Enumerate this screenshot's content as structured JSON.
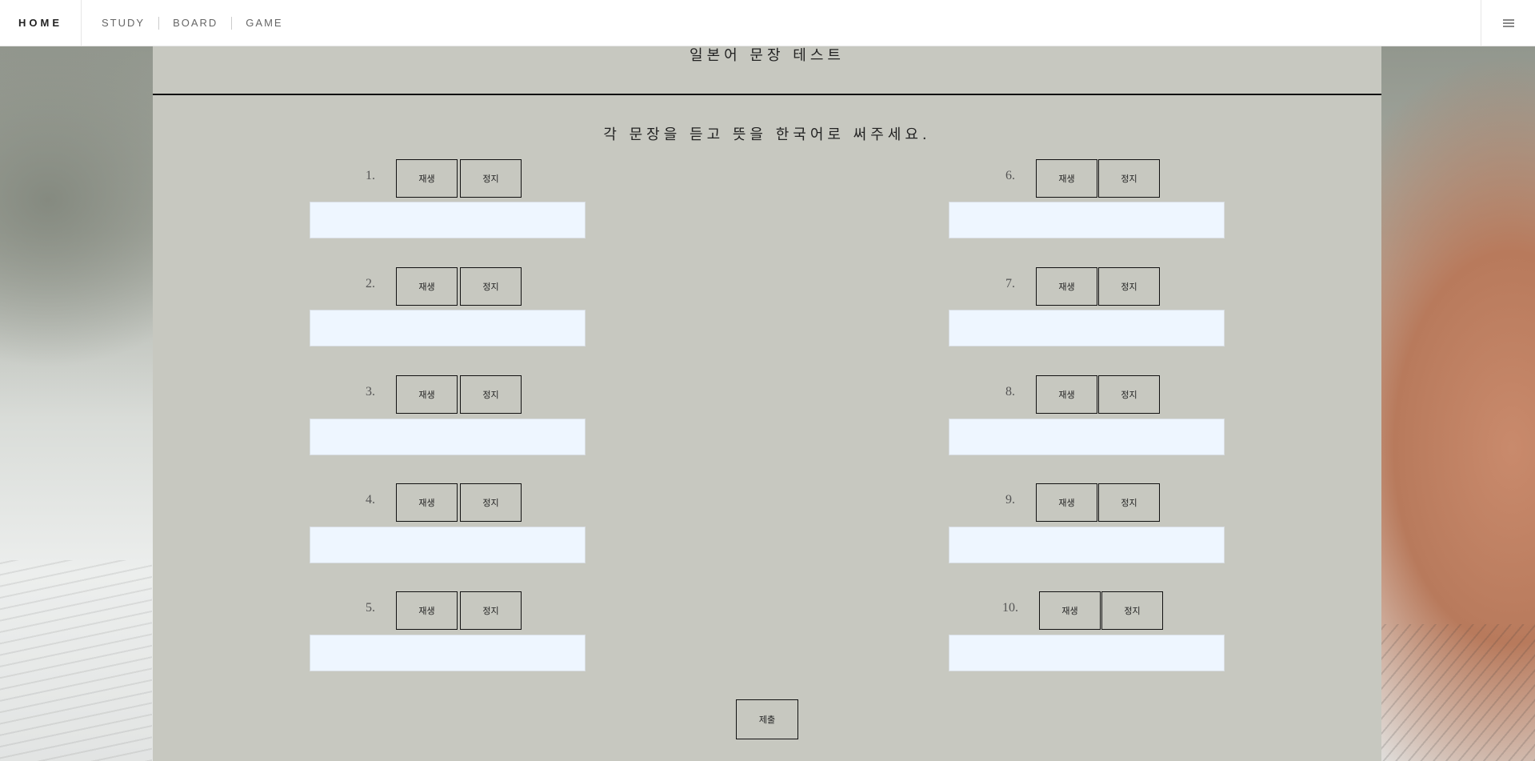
{
  "nav": {
    "brand": "HOME",
    "items": [
      {
        "label": "STUDY"
      },
      {
        "label": "BOARD"
      },
      {
        "label": "GAME"
      }
    ],
    "menu_icon": "hamburger-menu-icon"
  },
  "page": {
    "title": "일본어 문장 테스트",
    "instruction": "각 문장을 듣고 뜻을 한국어로 써주세요.",
    "play_label": "재생",
    "stop_label": "정지",
    "submit_label": "제출"
  },
  "questions": [
    {
      "number": "1.",
      "answer": ""
    },
    {
      "number": "2.",
      "answer": ""
    },
    {
      "number": "3.",
      "answer": ""
    },
    {
      "number": "4.",
      "answer": ""
    },
    {
      "number": "5.",
      "answer": ""
    },
    {
      "number": "6.",
      "answer": ""
    },
    {
      "number": "7.",
      "answer": ""
    },
    {
      "number": "8.",
      "answer": ""
    },
    {
      "number": "9.",
      "answer": ""
    },
    {
      "number": "10.",
      "answer": ""
    }
  ],
  "colors": {
    "panel": "#c7c8c0",
    "input_bg": "#eef6ff",
    "border": "#111111"
  }
}
